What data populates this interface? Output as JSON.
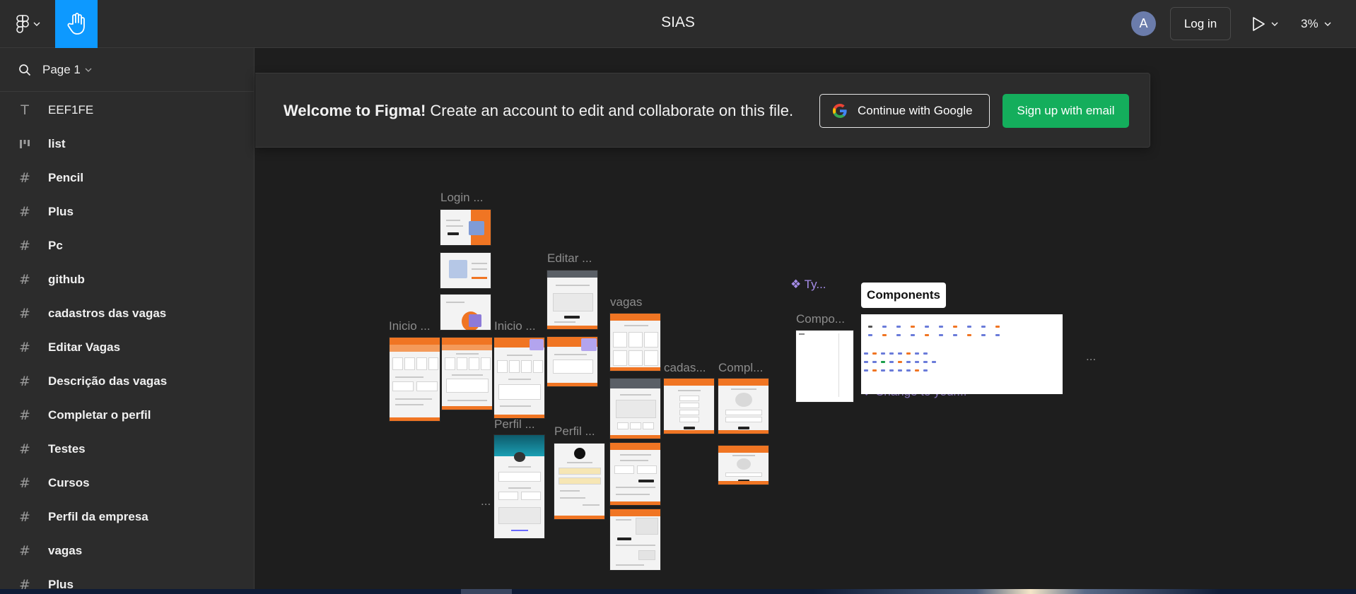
{
  "topbar": {
    "file_title": "SIAS",
    "avatar_letter": "A",
    "login_label": "Log in",
    "zoom_level": "3%"
  },
  "sidebar": {
    "page_label": "Page 1",
    "layers": [
      {
        "name": "EEF1FE",
        "icon": "text-icon"
      },
      {
        "name": "list",
        "icon": "component-icon"
      },
      {
        "name": "Pencil",
        "icon": "frame-icon"
      },
      {
        "name": "Plus",
        "icon": "frame-icon"
      },
      {
        "name": "Pc",
        "icon": "frame-icon"
      },
      {
        "name": "github",
        "icon": "frame-icon"
      },
      {
        "name": "cadastros das vagas",
        "icon": "frame-icon"
      },
      {
        "name": "Editar Vagas",
        "icon": "frame-icon"
      },
      {
        "name": "Descrição das vagas",
        "icon": "frame-icon"
      },
      {
        "name": "Completar o perfil",
        "icon": "frame-icon"
      },
      {
        "name": "Testes",
        "icon": "frame-icon"
      },
      {
        "name": "Cursos",
        "icon": "frame-icon"
      },
      {
        "name": "Perfil da empresa",
        "icon": "frame-icon"
      },
      {
        "name": "vagas",
        "icon": "frame-icon"
      },
      {
        "name": "Plus",
        "icon": "frame-icon"
      }
    ]
  },
  "banner": {
    "welcome_bold": "Welcome to Figma!",
    "welcome_rest": " Create an account to edit and collaborate on this file.",
    "google_label": "Continue with Google",
    "email_label": "Sign up with email"
  },
  "canvas": {
    "labels": {
      "login": "Login ...",
      "editar": "Editar ...",
      "vagas": "vagas",
      "inicio1": "Inicio ...",
      "inicio2": "Inicio ...",
      "cadas": "cadas...",
      "compl": "Compl...",
      "perfil1": "Perfil ...",
      "perfil2": "Perfil ...",
      "dots1": "...",
      "dots2": "...",
      "types": "❖ Ty...",
      "compo": "Compo...",
      "components": "Components",
      "change": "❖ Change to your..."
    }
  },
  "colors": {
    "accent": "#0d99ff",
    "signup": "#14ae5c",
    "orange": "#f07523"
  }
}
